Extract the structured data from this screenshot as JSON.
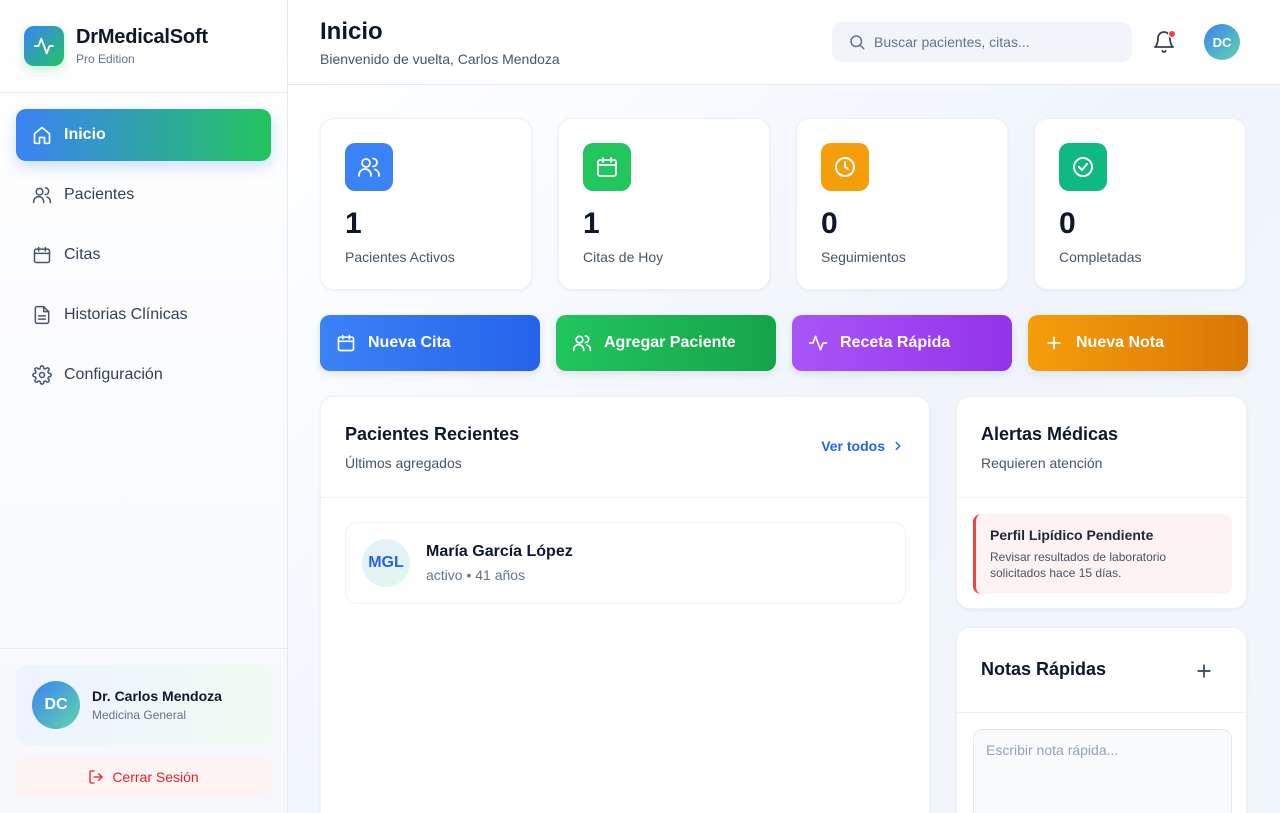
{
  "brand": {
    "name": "DrMedicalSoft",
    "edition": "Pro Edition",
    "logo_icon": "activity-icon"
  },
  "sidebar": {
    "items": [
      {
        "label": "Inicio",
        "icon": "home-icon",
        "active": true
      },
      {
        "label": "Pacientes",
        "icon": "users-icon",
        "active": false
      },
      {
        "label": "Citas",
        "icon": "calendar-icon",
        "active": false
      },
      {
        "label": "Historias Clínicas",
        "icon": "file-text-icon",
        "active": false
      },
      {
        "label": "Configuración",
        "icon": "gear-icon",
        "active": false
      }
    ],
    "user": {
      "initials": "DC",
      "name": "Dr. Carlos Mendoza",
      "role": "Medicina General"
    },
    "logout_label": "Cerrar Sesión"
  },
  "header": {
    "title": "Inicio",
    "subtitle": "Bienvenido de vuelta, Carlos Mendoza",
    "search_placeholder": "Buscar pacientes, citas...",
    "avatar_initials": "DC",
    "has_notifications": true
  },
  "stats": [
    {
      "value": "1",
      "label": "Pacientes Activos",
      "icon": "users-icon",
      "color": "#3b82f6"
    },
    {
      "value": "1",
      "label": "Citas de Hoy",
      "icon": "calendar-icon",
      "color": "#22c55e"
    },
    {
      "value": "0",
      "label": "Seguimientos",
      "icon": "clock-icon",
      "color": "#f59e0b"
    },
    {
      "value": "0",
      "label": "Completadas",
      "icon": "check-circle-icon",
      "color": "#10b981"
    }
  ],
  "quick_actions": [
    {
      "label": "Nueva Cita",
      "icon": "calendar-icon",
      "color": "#3b82f6"
    },
    {
      "label": "Agregar Paciente",
      "icon": "users-icon",
      "color": "#22c55e"
    },
    {
      "label": "Receta Rápida",
      "icon": "activity-icon",
      "color": "#a855f7"
    },
    {
      "label": "Nueva Nota",
      "icon": "plus-icon",
      "color": "#f59e0b"
    }
  ],
  "recent_patients": {
    "title": "Pacientes Recientes",
    "subtitle": "Últimos agregados",
    "view_all": "Ver todos",
    "patients": [
      {
        "initials": "MGL",
        "name": "María García López",
        "meta": "activo • 41 años"
      }
    ]
  },
  "alerts": {
    "title": "Alertas Médicas",
    "subtitle": "Requieren atención",
    "items": [
      {
        "title": "Perfil Lipídico Pendiente",
        "text": "Revisar resultados de laboratorio solicitados hace 15 días."
      }
    ]
  },
  "notes": {
    "title": "Notas Rápidas",
    "placeholder": "Escribir nota rápida..."
  }
}
